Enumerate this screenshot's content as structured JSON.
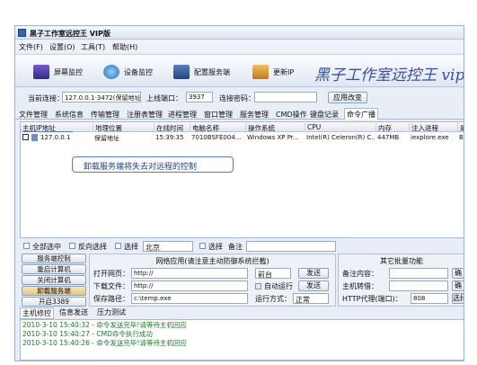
{
  "window": {
    "title": "黑子工作室远控王 VIP版"
  },
  "menu": [
    "文件(F)",
    "设置(O)",
    "工具(T)",
    "帮助(H)"
  ],
  "toolbar": {
    "screen": "屏幕监控",
    "device": "设备监控",
    "config": "配置服务端",
    "update_ip": "更新IP",
    "banner": "黑子工作室远控王 vip"
  },
  "conn": {
    "current_label": "当前连接：",
    "current_value": "127.0.0.1-3472(保留地址",
    "online_port_label": "上线端口：",
    "online_port_value": "3937",
    "password_label": "连接密码：",
    "apply_button": "应用改变"
  },
  "tabs": [
    "文件管理",
    "系统信息",
    "传输管理",
    "注册表管理",
    "进程管理",
    "窗口管理",
    "服务管理",
    "CMD操作",
    "键盘记录",
    "命令广播"
  ],
  "table": {
    "headers": [
      "主机IP地址",
      "地理位置",
      "在线时间",
      "电脑名称",
      "操作系统",
      "CPU",
      "内存",
      "注入进程",
      "是"
    ],
    "rows": [
      {
        "ip": "127.0.0.1",
        "location": "保留地址",
        "time": "15:39:35",
        "name": "7010BSFE004...",
        "os": "Windows XP Pr...",
        "cpu": "Intel(R) Celeron(R) C...",
        "mem": "447MB",
        "proc": "iexplore.exe",
        "extra": "B"
      }
    ],
    "tooltip": "卸载服务端将失去对远程的控制"
  },
  "selection": {
    "select_all": "全部选中",
    "invert": "反向选择",
    "select": "选择",
    "region": "北京",
    "select2": "选择",
    "note": "备注"
  },
  "left_buttons": [
    "服务端控制",
    "重启计算机",
    "关闭计算机",
    "卸载服务端",
    "开启3389"
  ],
  "network": {
    "title": "网络应用(请注意主动防御系统拦截)",
    "open_url_label": "打开网页：",
    "open_url_value": "http://",
    "mode": "前台",
    "send1": "发送",
    "download_label": "下载文件：",
    "download_value": "http://",
    "auto_run": "自动运行",
    "send2": "发送",
    "save_path_label": "保存路径：",
    "save_path_value": "c:\\temp.exe",
    "run_mode_label": "运行方式：",
    "run_mode_value": "正常"
  },
  "batch": {
    "title": "其它批量功能",
    "note_label": "备注内容：",
    "host_label": "主机转借：",
    "proxy_label": "HTTP代理(端口)：",
    "proxy_value": "808",
    "btn1": "确",
    "btn2": "确",
    "btn3": "选择"
  },
  "bottom_tabs": [
    "主机修控",
    "信息发送",
    "压力测试"
  ],
  "log": [
    "2010-3-10 15:40:32 - 命令发送完毕!请等待主机回应",
    "2010-3-10 15:40:27 - CMD命令执行成功",
    "2010-3-10 15:40:26 - 命令发送完毕!请等待主机回应"
  ]
}
